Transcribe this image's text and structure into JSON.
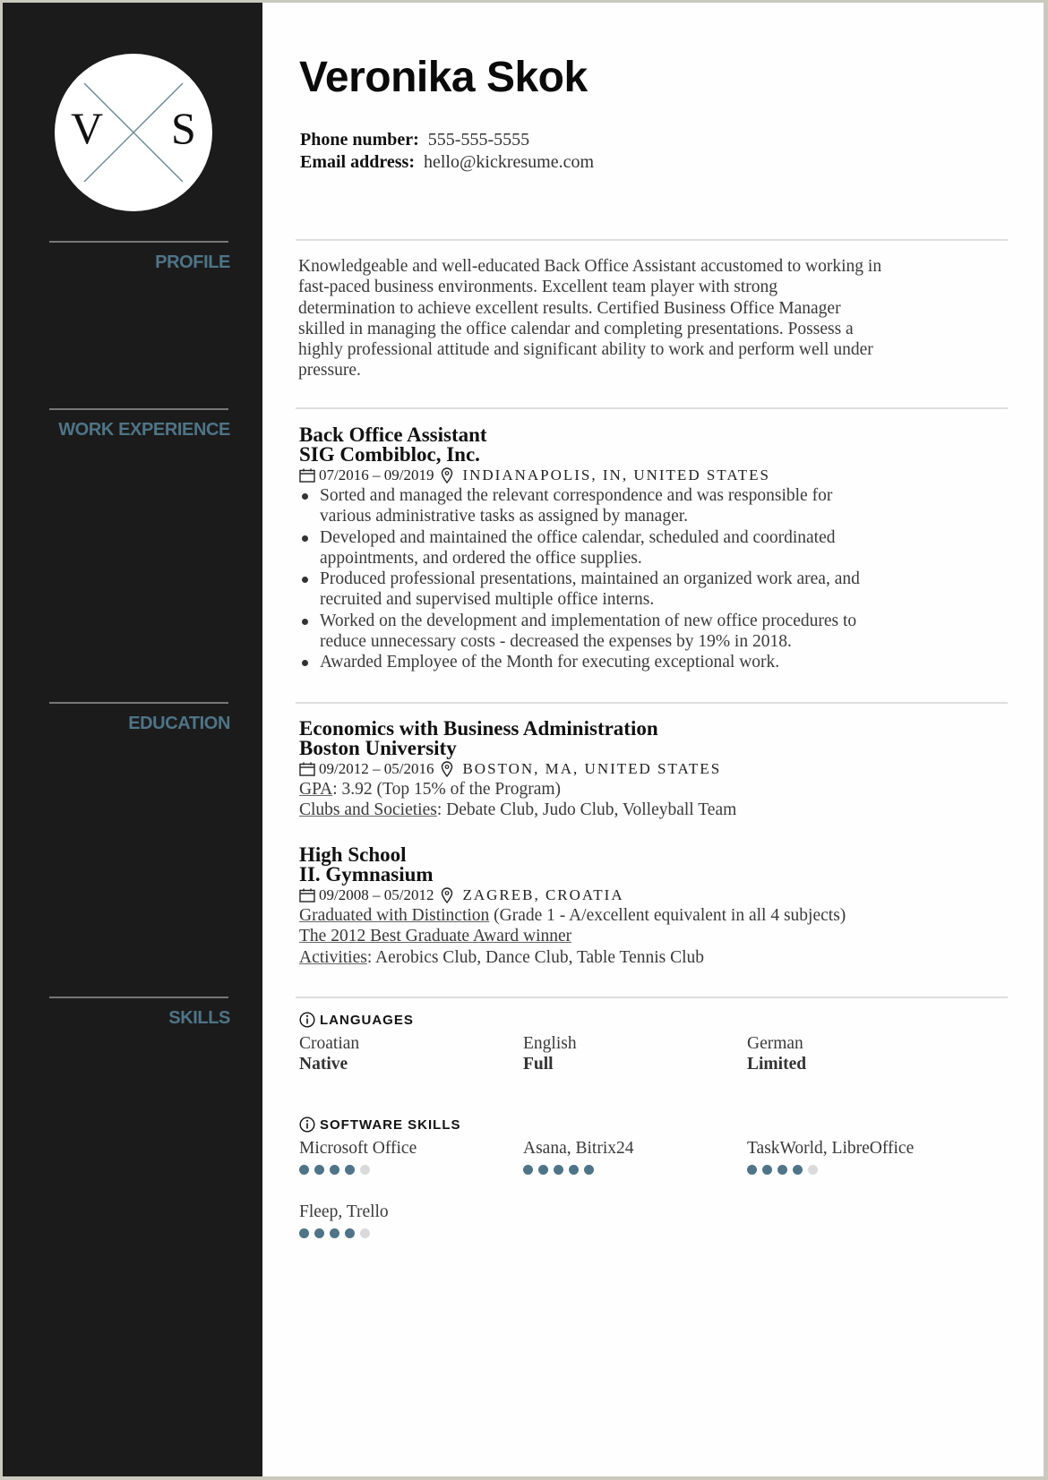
{
  "colors": {
    "accent": "#4f7487",
    "sidebar": "#1b1b1b",
    "dot_off": "#dadada"
  },
  "monogram": {
    "left": "V",
    "right": "S"
  },
  "header": {
    "name": "Veronika Skok",
    "phone_label": "Phone number:",
    "phone": "555-555-5555",
    "email_label": "Email address:",
    "email": "hello@kickresume.com"
  },
  "sections": {
    "profile": "PROFILE",
    "work": "WORK EXPERIENCE",
    "education": "EDUCATION",
    "skills": "SKILLS"
  },
  "profile": {
    "lines": [
      "Knowledgeable and well-educated Back Office Assistant accustomed to working in",
      "fast-paced business environments. Excellent team player with strong",
      "determination to achieve excellent results. Certified Business Office Manager",
      "skilled in managing the office calendar and completing presentations. Possess a",
      "highly professional attitude and significant ability to work and perform well under",
      "pressure."
    ]
  },
  "work": [
    {
      "title": "Back Office Assistant",
      "company": "SIG Combibloc, Inc.",
      "dates": "07/2016 – 09/2019",
      "location": "INDIANAPOLIS, IN, UNITED STATES",
      "bullets": [
        [
          "Sorted and managed the relevant correspondence and was responsible for",
          "various administrative tasks as assigned by manager."
        ],
        [
          "Developed and maintained the office calendar, scheduled and coordinated",
          "appointments, and ordered the office supplies."
        ],
        [
          "Produced professional presentations, maintained an organized work area, and",
          "recruited and supervised multiple office interns."
        ],
        [
          "Worked on the development and implementation of new office procedures to",
          "reduce unnecessary costs - decreased the expenses by 19% in 2018."
        ],
        [
          "Awarded Employee of the Month for executing exceptional work."
        ]
      ]
    }
  ],
  "education": [
    {
      "degree": "Economics with Business Administration",
      "school": "Boston University",
      "dates": "09/2012 – 05/2016",
      "location": "BOSTON, MA, UNITED STATES",
      "details": [
        {
          "label": "GPA",
          "text": ": 3.92 (Top 15% of the Program)"
        },
        {
          "label": "Clubs and Societies",
          "text": ": Debate Club, Judo Club, Volleyball Team"
        }
      ]
    },
    {
      "degree": "High School",
      "school": "II. Gymnasium",
      "dates": "09/2008 – 05/2012",
      "location": "ZAGREB, CROATIA",
      "details": [
        {
          "label": "Graduated with Distinction",
          "text": " (Grade 1 - A/excellent equivalent in all 4 subjects)"
        },
        {
          "label": "The 2012 Best Graduate Award winner",
          "text": ""
        },
        {
          "label": "Activities",
          "text": ": Aerobics Club, Dance Club, Table Tennis Club"
        }
      ]
    }
  ],
  "skills": {
    "languages_title": "LANGUAGES",
    "languages": [
      {
        "name": "Croatian",
        "level": "Native"
      },
      {
        "name": "English",
        "level": "Full"
      },
      {
        "name": "German",
        "level": "Limited"
      }
    ],
    "software_title": "SOFTWARE SKILLS",
    "software": [
      {
        "name": "Microsoft Office",
        "rating": 4,
        "max": 5
      },
      {
        "name": "Asana, Bitrix24",
        "rating": 5,
        "max": 5
      },
      {
        "name": "TaskWorld, LibreOffice",
        "rating": 4,
        "max": 5
      },
      {
        "name": "Fleep, Trello",
        "rating": 4,
        "max": 5
      }
    ]
  }
}
